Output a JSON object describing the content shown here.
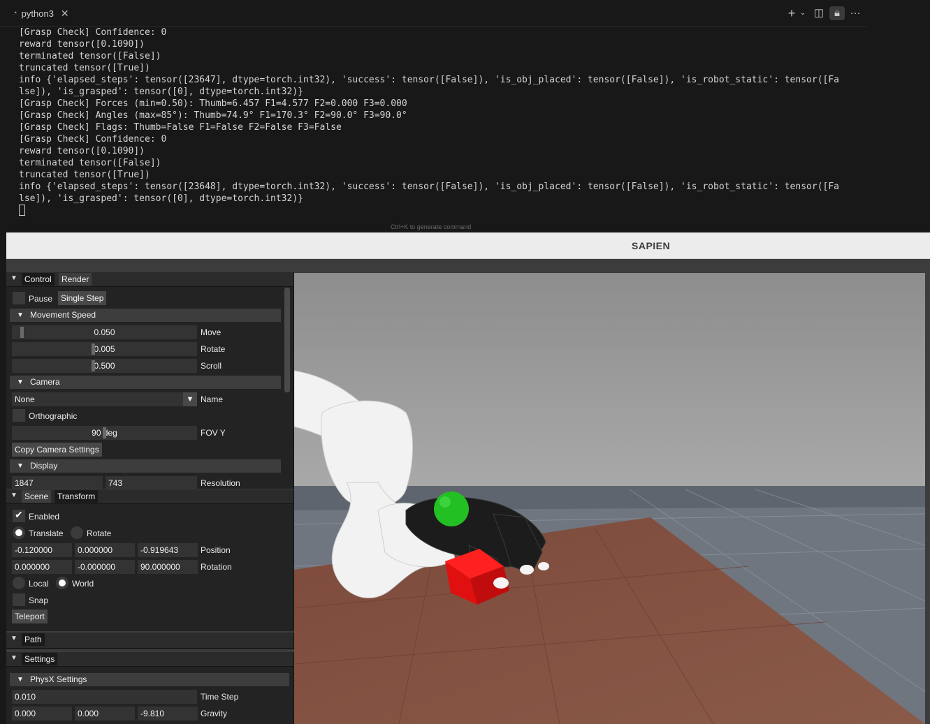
{
  "terminal": {
    "tab_title": "python3",
    "hint": "Ctrl+K to generate command",
    "lines": [
      "[Grasp Check] Confidence: 0",
      "reward tensor([0.1090])",
      "terminated tensor([False])",
      "truncated tensor([True])",
      "info {'elapsed_steps': tensor([23647], dtype=torch.int32), 'success': tensor([False]), 'is_obj_placed': tensor([False]), 'is_robot_static': tensor([Fa",
      "lse]), 'is_grasped': tensor([0], dtype=torch.int32)}",
      "[Grasp Check] Forces (min=0.50): Thumb=6.457 F1=4.577 F2=0.000 F3=0.000",
      "[Grasp Check] Angles (max=85°): Thumb=74.9° F1=170.3° F2=90.0° F3=90.0°",
      "[Grasp Check] Flags: Thumb=False F1=False F2=False F3=False",
      "[Grasp Check] Confidence: 0",
      "reward tensor([0.1090])",
      "terminated tensor([False])",
      "truncated tensor([True])",
      "info {'elapsed_steps': tensor([23648], dtype=torch.int32), 'success': tensor([False]), 'is_obj_placed': tensor([False]), 'is_robot_static': tensor([Fa",
      "lse]), 'is_grasped': tensor([0], dtype=torch.int32)}"
    ]
  },
  "window": {
    "title": "SAPIEN"
  },
  "control": {
    "tabs": [
      "Control",
      "Render"
    ],
    "pause_label": "Pause",
    "single_step_label": "Single Step",
    "movement_speed": {
      "header": "Movement Speed",
      "move": {
        "value": "0.050",
        "label": "Move"
      },
      "rotate": {
        "value": "0.005",
        "label": "Rotate"
      },
      "scroll": {
        "value": "0.500",
        "label": "Scroll"
      }
    },
    "camera": {
      "header": "Camera",
      "name_value": "None",
      "name_label": "Name",
      "orthographic_label": "Orthographic",
      "fov_value": "90 deg",
      "fov_label": "FOV Y",
      "copy_button": "Copy Camera Settings"
    },
    "display": {
      "header": "Display",
      "width": "1847",
      "height": "743",
      "resolution_label": "Resolution"
    }
  },
  "scene": {
    "tabs": [
      "Scene",
      "Transform"
    ],
    "enabled_label": "Enabled",
    "enabled": true,
    "translate_label": "Translate",
    "rotate_label": "Rotate",
    "position": [
      "-0.120000",
      "0.000000",
      "-0.919643"
    ],
    "position_label": "Position",
    "rotation": [
      "0.000000",
      "-0.000000",
      "90.000000"
    ],
    "rotation_label": "Rotation",
    "local_label": "Local",
    "world_label": "World",
    "snap_label": "Snap",
    "teleport_button": "Teleport"
  },
  "path": {
    "tab": "Path"
  },
  "settings": {
    "tab": "Settings",
    "physx_header": "PhysX Settings",
    "time_step": "0.010",
    "time_step_label": "Time Step",
    "gravity": [
      "0.000",
      "0.000",
      "-9.810"
    ],
    "gravity_label": "Gravity"
  },
  "colors": {
    "terminal_bg": "#181818",
    "panel_bg": "#232323",
    "cube": "#e01010",
    "sphere": "#22c022",
    "table": "#7a4a3a",
    "floor": "#7a8088"
  }
}
